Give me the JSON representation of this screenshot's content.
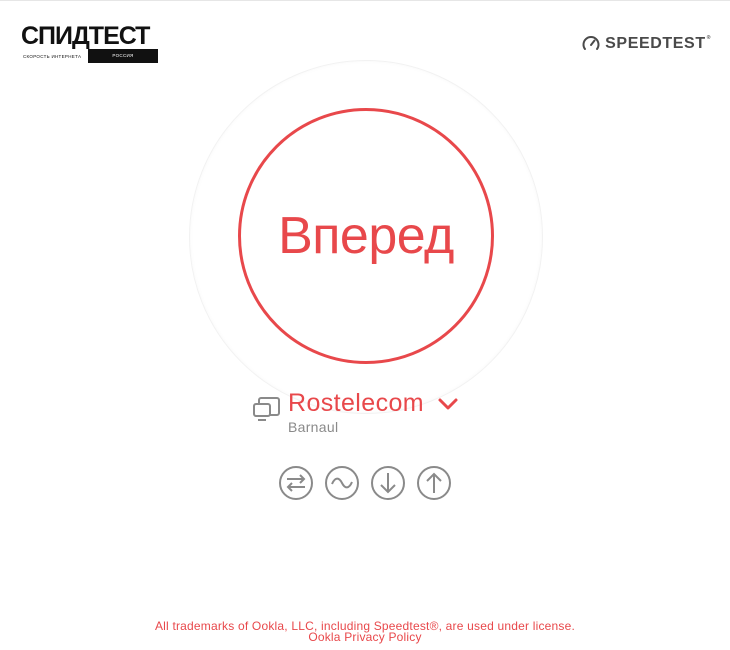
{
  "logo": {
    "title": "СПИДТЕСТ",
    "subtitle_left": "СКОРОСТЬ ИНТЕРНЕТА",
    "subtitle_right": "РОССИЯ"
  },
  "brand": {
    "name": "SPEEDTEST",
    "tm": "®",
    "icon": "speedometer-icon"
  },
  "go_button": {
    "label": "Вперед"
  },
  "server": {
    "name": "Rostelecom",
    "city": "Barnaul",
    "icon": "connection-icon"
  },
  "metrics": [
    {
      "icon": "ping-icon"
    },
    {
      "icon": "jitter-icon"
    },
    {
      "icon": "download-icon"
    },
    {
      "icon": "upload-icon"
    }
  ],
  "footer": {
    "trademark": "All trademarks of Ookla, LLC, including Speedtest®, are used under license.",
    "privacy": "Ookla Privacy Policy"
  },
  "colors": {
    "accent": "#e8484b",
    "text_muted": "#8a8a8a",
    "brand_gray": "#4a4a4a"
  }
}
